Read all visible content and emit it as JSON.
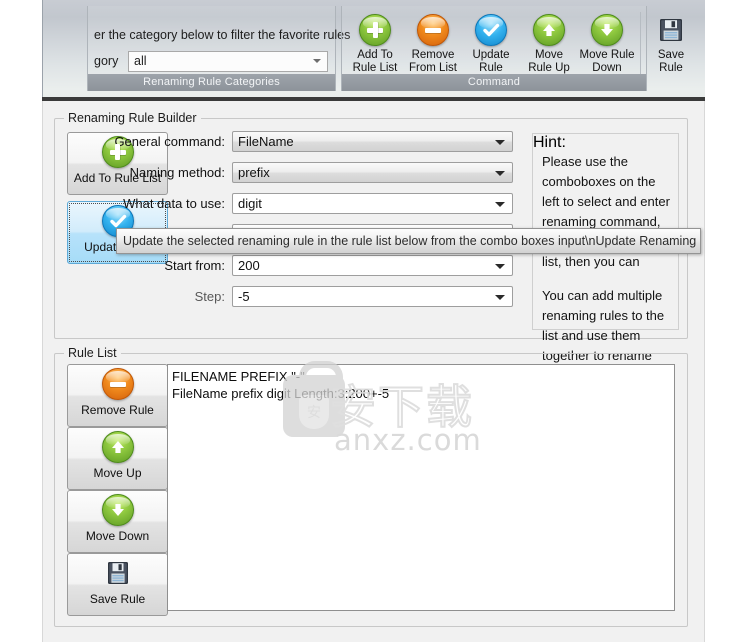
{
  "ribbon": {
    "groups": [
      {
        "caption": "Renaming Rule Categories",
        "hint_text": "er the category below to filter the favorite rules",
        "category_label": "gory",
        "category_value": "all"
      },
      {
        "caption": "Command",
        "buttons": [
          {
            "icon": "plus-circle-icon",
            "line1": "Add To",
            "line2": "Rule List"
          },
          {
            "icon": "minus-circle-icon",
            "line1": "Remove",
            "line2": "From List"
          },
          {
            "icon": "check-circle-icon",
            "line1": "Update",
            "line2": "Rule"
          },
          {
            "icon": "arrow-up-circle-icon",
            "line1": "Move",
            "line2": "Rule Up"
          },
          {
            "icon": "arrow-down-circle-icon",
            "line1": "Move Rule",
            "line2": "Down"
          },
          {
            "icon": "floppy-disk-icon",
            "line1": "Save",
            "line2": "Rule"
          }
        ]
      }
    ]
  },
  "builder": {
    "legend": "Renaming Rule Builder",
    "buttons": [
      {
        "icon": "plus-circle-icon",
        "label": "Add To Rule List",
        "state": "normal"
      },
      {
        "icon": "check-circle-icon",
        "label": "Update Rule",
        "state": "hovered"
      }
    ],
    "fields": [
      {
        "label": "General command:",
        "value": "FileName",
        "style": "gray"
      },
      {
        "label": "Naming method:",
        "value": "prefix",
        "style": "gray"
      },
      {
        "label": "What data to use:",
        "value": "digit",
        "style": "white"
      },
      {
        "label": "Start from:",
        "value": "200",
        "style": "white"
      },
      {
        "label": "Step:",
        "value": "-5",
        "style": "white",
        "dim": true
      }
    ]
  },
  "hint": {
    "legend": "Hint:",
    "paragraphs": [
      "Please use the comboboxes on the left to select and enter renaming command, and add it to the rule list, then you can",
      "You can add multiple renaming rules to the list and use them together to rename files."
    ]
  },
  "rule_list": {
    "legend": "Rule List",
    "buttons": [
      {
        "icon": "minus-circle-icon",
        "label": "Remove Rule"
      },
      {
        "icon": "arrow-up-circle-icon",
        "label": "Move Up"
      },
      {
        "icon": "arrow-down-circle-icon",
        "label": "Move Down"
      },
      {
        "icon": "floppy-disk-icon",
        "label": "Save Rule"
      }
    ],
    "lines": [
      "FILENAME PREFIX \"-\"",
      "FileName prefix digit Length:3:200+-5"
    ]
  },
  "tooltip": {
    "text": "Update the selected renaming rule in the rule list below from the combo boxes input\\nUpdate Renaming Rul"
  },
  "watermark": {
    "cjk": "安下载",
    "domain": "anxz.com",
    "badge": "安"
  },
  "colors": {
    "green": "#8cc63e",
    "orange": "#f08a1d",
    "blue": "#35b3ef",
    "ribbon_caption_bg": "#949aa1",
    "hover_blue": "#b7e2fa"
  }
}
